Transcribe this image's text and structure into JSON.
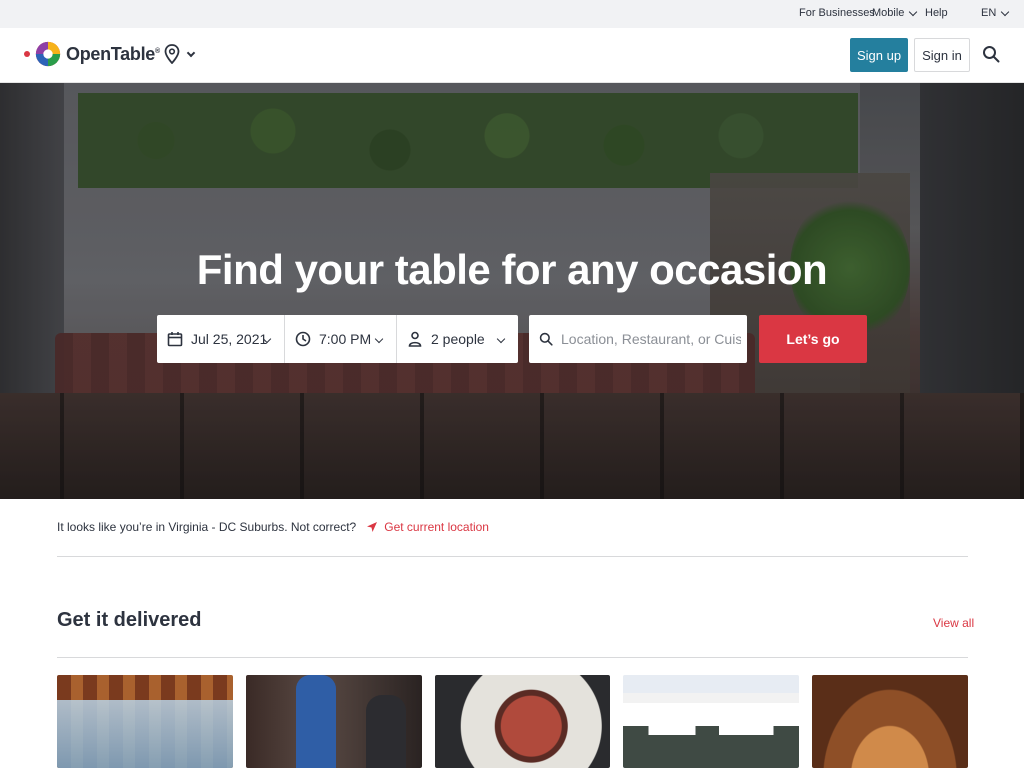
{
  "utility_bar": {
    "for_businesses": "For Businesses",
    "mobile": "Mobile",
    "help": "Help",
    "language": "EN"
  },
  "header": {
    "brand": "OpenTable",
    "brand_mark": "®",
    "sign_up": "Sign up",
    "sign_in": "Sign in"
  },
  "hero": {
    "title": "Find your table for any occasion",
    "date": "Jul 25, 2021",
    "time": "7:00 PM",
    "party_size": "2 people",
    "search_placeholder": "Location, Restaurant, or Cuisine",
    "search_value": "",
    "submit": "Let’s go"
  },
  "location_notice": {
    "text": "It looks like you’re in Virginia - DC Suburbs. Not correct?",
    "action": "Get current location"
  },
  "delivered": {
    "title": "Get it delivered",
    "view_all": "View all"
  },
  "colors": {
    "brand_red": "#da3743",
    "sign_up_blue": "#247f9e",
    "text_dark": "#2d333f"
  },
  "icons": [
    "location-pin-icon",
    "calendar-icon",
    "clock-icon",
    "person-icon",
    "search-icon",
    "navigation-arrow-icon",
    "chevron-down-icon"
  ]
}
